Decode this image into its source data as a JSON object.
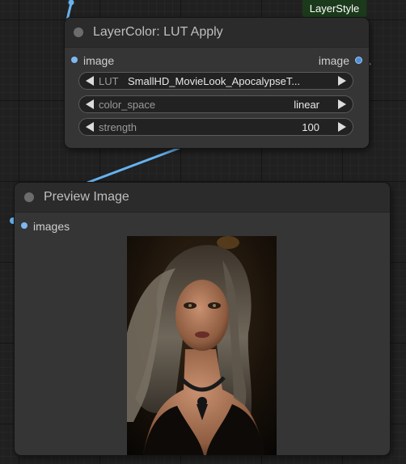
{
  "badge": "LayerStyle",
  "lut_node": {
    "title": "LayerColor: LUT Apply",
    "input_label": "image",
    "output_label": "image",
    "widgets": [
      {
        "name": "LUT",
        "value": "SmallHD_MovieLook_ApocalypseT..."
      },
      {
        "name": "color_space",
        "value": "linear"
      },
      {
        "name": "strength",
        "value": "100"
      }
    ]
  },
  "preview_node": {
    "title": "Preview Image",
    "input_label": "images"
  },
  "colors": {
    "link": "#66b3f0",
    "node_body": "#353535",
    "node_title": "#2b2b2b",
    "badge_bg": "#1b3a1b"
  },
  "icons": {
    "title_dot": "node-collapse-dot",
    "widget_left": "decrement-arrow",
    "widget_right": "increment-arrow"
  }
}
